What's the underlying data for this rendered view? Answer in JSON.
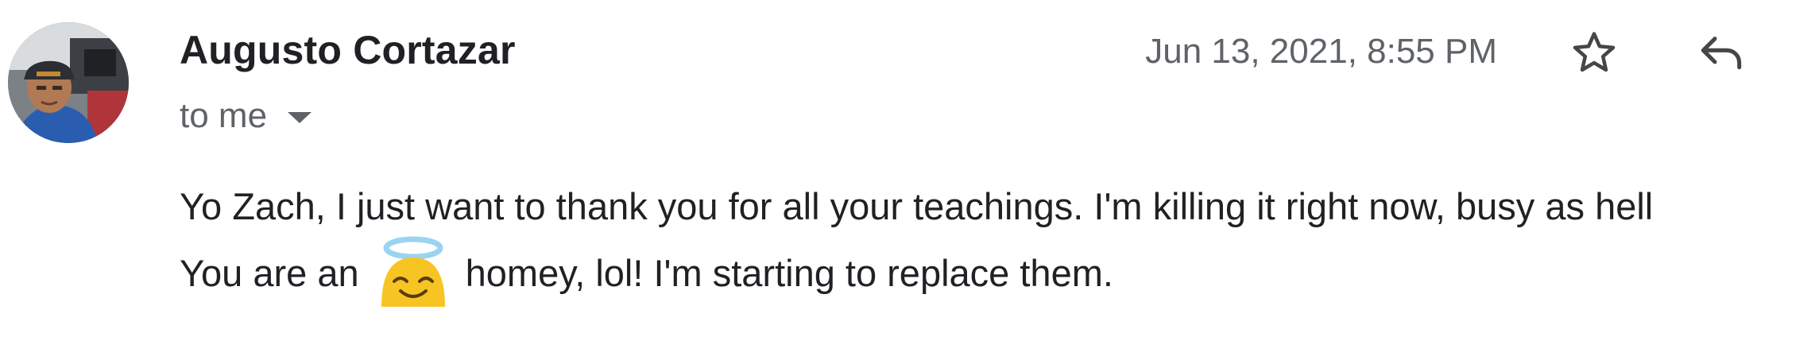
{
  "sender": {
    "name": "Augusto Cortazar"
  },
  "recipient": {
    "label": "to me",
    "details_icon": "caret-down-icon"
  },
  "timestamp": "Jun 13, 2021, 8:55 PM",
  "actions": {
    "star_icon": "star-outline-icon",
    "reply_icon": "reply-arrow-icon"
  },
  "message": {
    "line1": "Yo Zach, I just want to thank you for all your teachings. I'm killing it right now, busy as hell",
    "line2_before": "You are an",
    "emoji": "smiling-face-with-halo-emoji",
    "line2_after": "homey, lol! I'm starting to replace them."
  },
  "colors": {
    "primary_text": "#202124",
    "secondary_text": "#5f6368",
    "emoji_face": "#f7c523",
    "halo": "#9ad4f0"
  }
}
